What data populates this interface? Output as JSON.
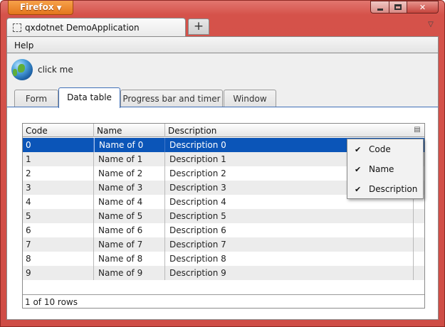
{
  "browser": {
    "menu_button": "Firefox",
    "tab_title": "qxdotnet DemoApplication",
    "new_tab": "+"
  },
  "menubar": {
    "help": "Help"
  },
  "toolbar": {
    "click_me": "click me"
  },
  "tabs": [
    {
      "label": "Form",
      "active": false
    },
    {
      "label": "Data table",
      "active": true
    },
    {
      "label": "Progress bar and timer",
      "active": false
    },
    {
      "label": "Window",
      "active": false
    }
  ],
  "table": {
    "columns": [
      "Code",
      "Name",
      "Description"
    ],
    "rows": [
      [
        "0",
        "Name of 0",
        "Description 0"
      ],
      [
        "1",
        "Name of 1",
        "Description 1"
      ],
      [
        "2",
        "Name of 2",
        "Description 2"
      ],
      [
        "3",
        "Name of 3",
        "Description 3"
      ],
      [
        "4",
        "Name of 4",
        "Description 4"
      ],
      [
        "5",
        "Name of 5",
        "Description 5"
      ],
      [
        "6",
        "Name of 6",
        "Description 6"
      ],
      [
        "7",
        "Name of 7",
        "Description 7"
      ],
      [
        "8",
        "Name of 8",
        "Description 8"
      ],
      [
        "9",
        "Name of 9",
        "Description 9"
      ]
    ],
    "selected_row": 0,
    "footer": "1 of 10 rows"
  },
  "column_menu": {
    "items": [
      {
        "label": "Code",
        "checked": true
      },
      {
        "label": "Name",
        "checked": true
      },
      {
        "label": "Description",
        "checked": true
      }
    ]
  },
  "colors": {
    "selection": "#0b55b8",
    "window_frame": "#cf4d46",
    "firefox_button": "#e4761c"
  }
}
